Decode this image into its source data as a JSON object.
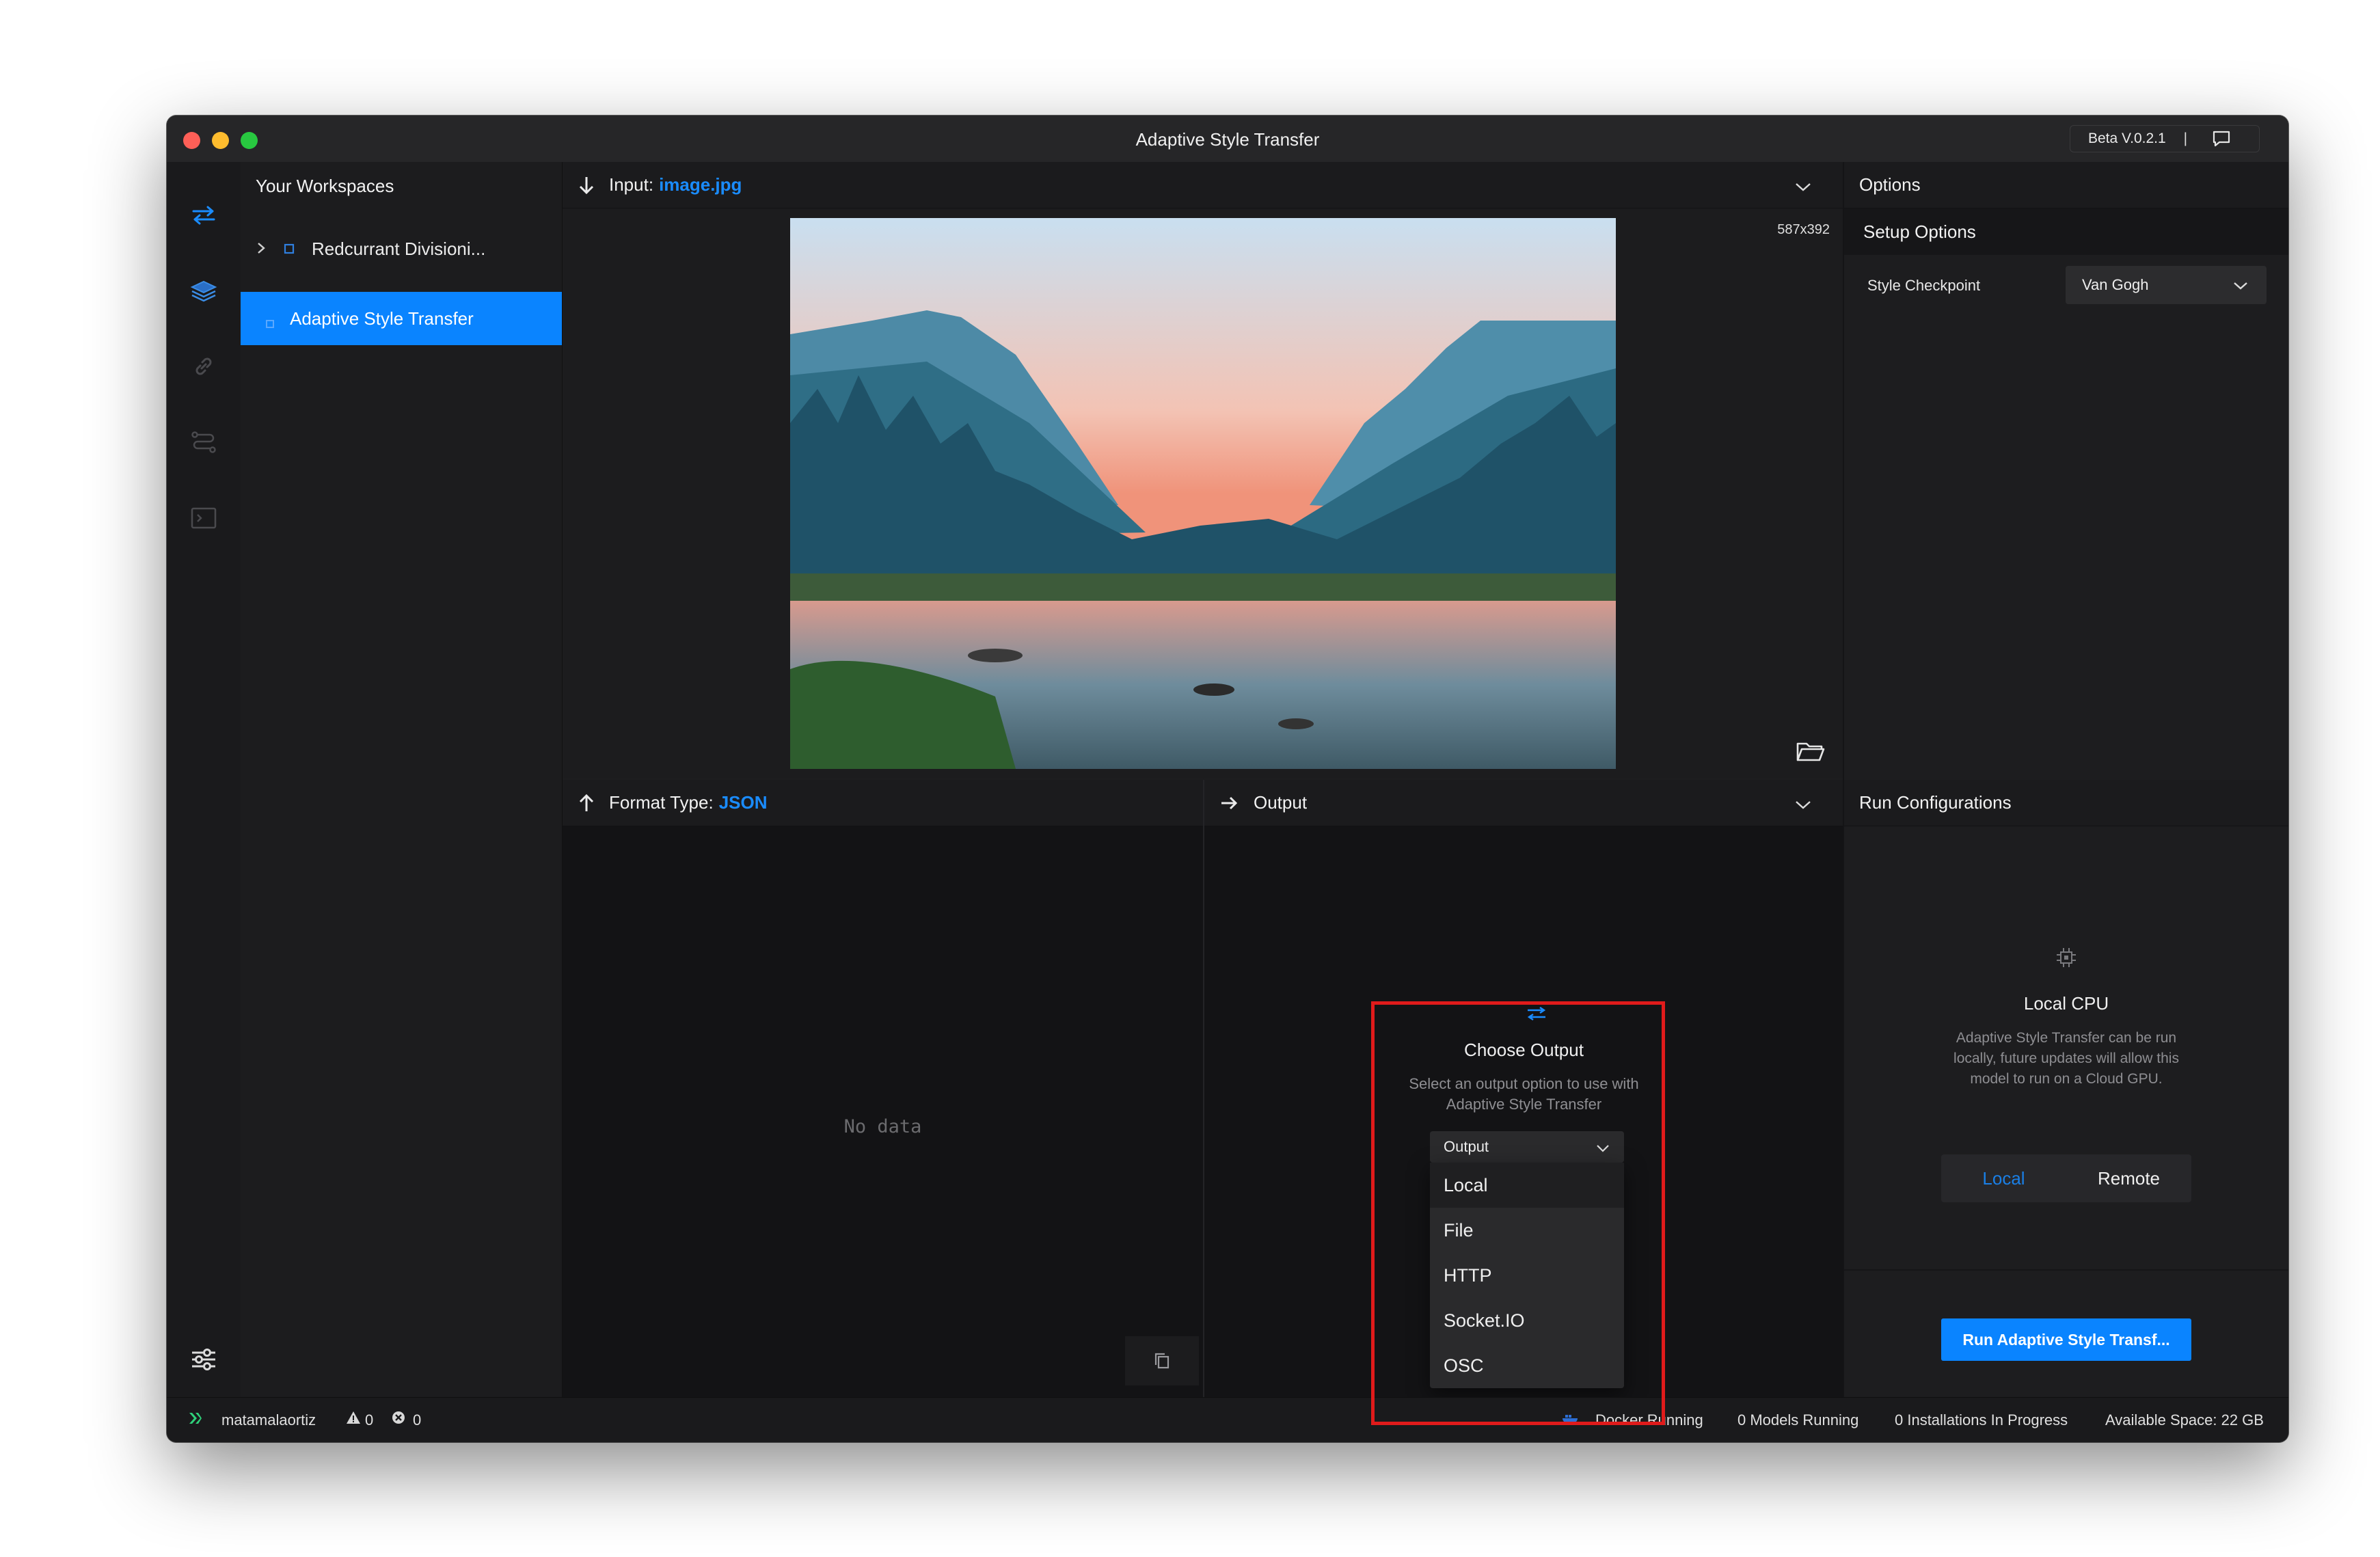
{
  "window": {
    "title": "Adaptive Style Transfer",
    "version": "Beta V.0.2.1",
    "version_separator": "|"
  },
  "rail": {
    "icons": [
      "swap-arrows-icon",
      "layers-icon",
      "link-icon",
      "route-icon",
      "terminal-icon",
      "settings-sliders-icon"
    ]
  },
  "sidebar": {
    "header": "Your Workspaces",
    "items": [
      {
        "label": "Redcurrant Divisioni...",
        "expanded": false
      },
      {
        "label": "Adaptive Style Transfer",
        "active": true
      }
    ]
  },
  "input": {
    "label": "Input:",
    "filename": "image.jpg",
    "dimensions": "587x392"
  },
  "options": {
    "header": "Options",
    "section": "Setup Options",
    "style_checkpoint_label": "Style Checkpoint",
    "style_checkpoint_value": "Van Gogh"
  },
  "format": {
    "label": "Format Type:",
    "value": "JSON",
    "empty_text": "No data"
  },
  "output": {
    "header": "Output",
    "choose_title": "Choose Output",
    "choose_desc_line1": "Select an output option to use with",
    "choose_desc_line2": "Adaptive Style Transfer",
    "select_placeholder": "Output",
    "options": [
      "Local",
      "File",
      "HTTP",
      "Socket.IO",
      "OSC"
    ]
  },
  "run": {
    "header": "Run Configurations",
    "target_title": "Local CPU",
    "desc_line1": "Adaptive Style Transfer can be run",
    "desc_line2": "locally, future updates will allow this",
    "desc_line3": "model to run on a Cloud GPU.",
    "toggle_local": "Local",
    "toggle_remote": "Remote",
    "run_button": "Run Adaptive Style Transf..."
  },
  "status": {
    "user": "matamalaortiz",
    "warnings": "0",
    "errors": "0",
    "docker": "Docker Running",
    "models": "0 Models Running",
    "installs": "0 Installations In Progress",
    "space": "Available Space: 22 GB"
  },
  "colors": {
    "accent": "#0a84ff",
    "annotation": "#e01b1b"
  }
}
